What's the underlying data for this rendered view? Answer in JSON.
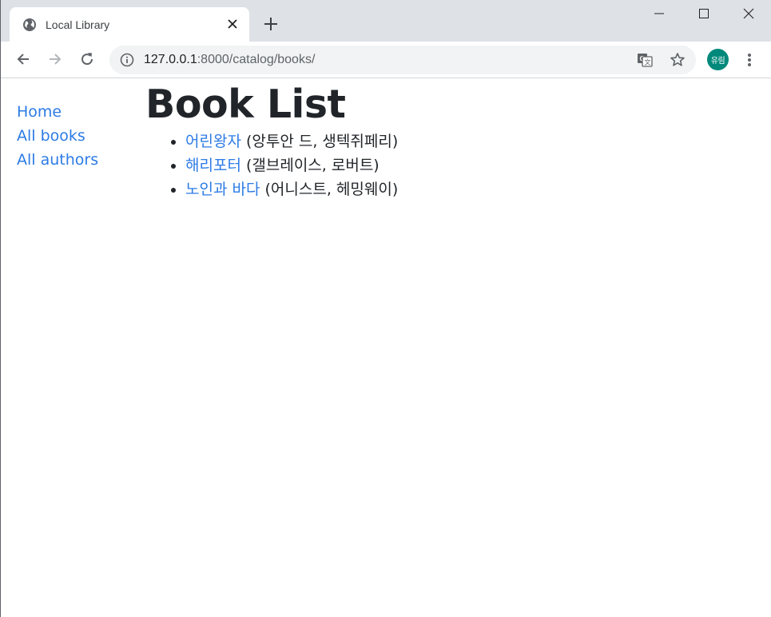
{
  "browser": {
    "tab": {
      "title": "Local Library"
    },
    "url": {
      "host": "127.0.0.1",
      "rest": ":8000/catalog/books/"
    },
    "profile": {
      "initials": "유림",
      "color": "#00897b"
    }
  },
  "sidebar": {
    "links": [
      "Home",
      "All books",
      "All authors"
    ]
  },
  "main": {
    "title": "Book List",
    "books": [
      {
        "title": "어린왕자",
        "author": "(앙투안 드, 생텍쥐페리)"
      },
      {
        "title": "해리포터",
        "author": "(갤브레이스, 로버트)"
      },
      {
        "title": "노인과 바다",
        "author": "(어니스트, 헤밍웨이)"
      }
    ]
  },
  "colors": {
    "link": "#2c7be5",
    "text": "#212529",
    "tabstrip": "#dee1e6",
    "omnibox": "#f1f3f4"
  },
  "icons": [
    "globe-icon",
    "close-icon",
    "plus-icon",
    "minimize-icon",
    "maximize-icon",
    "window-close-icon",
    "back-arrow-icon",
    "forward-arrow-icon",
    "reload-icon",
    "info-icon",
    "translate-icon",
    "star-icon",
    "kebab-menu-icon"
  ]
}
